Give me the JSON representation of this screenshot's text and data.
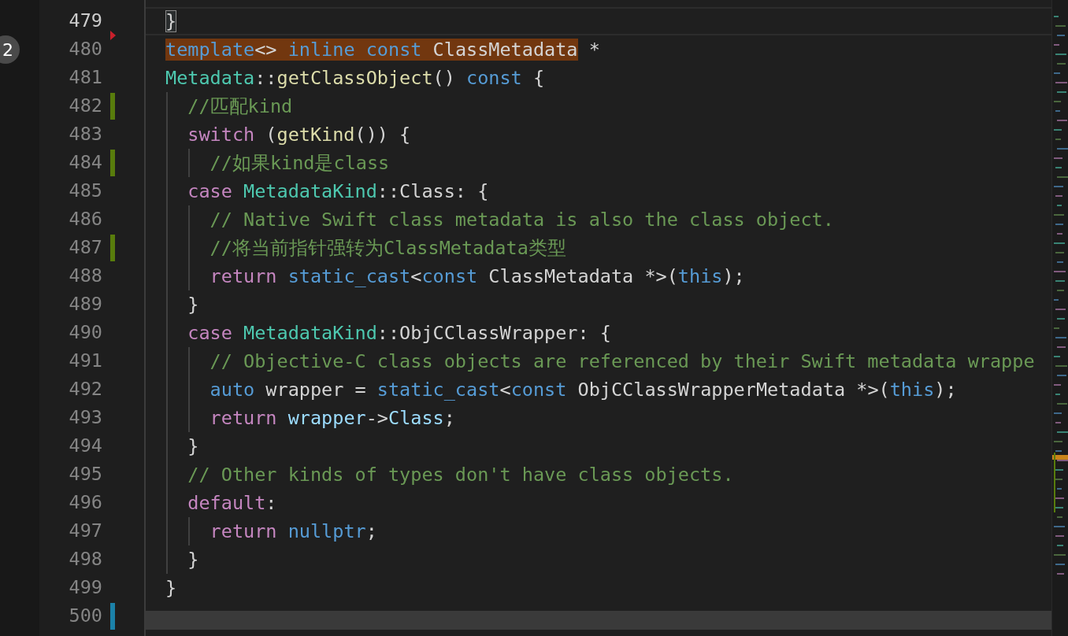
{
  "badge": "2",
  "lines": [
    {
      "number": "479",
      "current": true,
      "added": false,
      "modified": false,
      "deleted_above": false,
      "tokens": [
        {
          "kind": "bracket_match",
          "text": "}"
        }
      ]
    },
    {
      "number": "480",
      "current": false,
      "added": false,
      "modified": false,
      "deleted_above": true,
      "tokens": [
        {
          "kind": "match",
          "tokens": [
            {
              "kind": "keyword",
              "text": "template"
            },
            {
              "kind": "plain",
              "text": "<> "
            },
            {
              "kind": "keyword",
              "text": "inline "
            },
            {
              "kind": "keyword",
              "text": "const"
            },
            {
              "kind": "plain",
              "text": " ClassMetadata"
            }
          ]
        },
        {
          "kind": "plain",
          "text": " *"
        }
      ]
    },
    {
      "number": "481",
      "current": false,
      "added": false,
      "modified": false,
      "deleted_above": false,
      "tokens": [
        {
          "kind": "type",
          "text": "Metadata"
        },
        {
          "kind": "plain",
          "text": "::"
        },
        {
          "kind": "function",
          "text": "getClassObject"
        },
        {
          "kind": "plain",
          "text": "() "
        },
        {
          "kind": "keyword",
          "text": "const"
        },
        {
          "kind": "plain",
          "text": " {"
        }
      ],
      "children": [
        {
          "number": "482",
          "current": false,
          "added": true,
          "modified": false,
          "deleted_above": false,
          "tokens": [
            {
              "kind": "comment",
              "text": "//匹配kind"
            }
          ]
        },
        {
          "number": "483",
          "current": false,
          "added": false,
          "modified": false,
          "deleted_above": false,
          "tokens": [
            {
              "kind": "control",
              "text": "switch"
            },
            {
              "kind": "plain",
              "text": " ("
            },
            {
              "kind": "function",
              "text": "getKind"
            },
            {
              "kind": "plain",
              "text": "()) {"
            }
          ],
          "children": [
            {
              "number": "484",
              "current": false,
              "added": true,
              "modified": false,
              "deleted_above": false,
              "tokens": [
                {
                  "kind": "comment",
                  "text": "//如果kind是class"
                }
              ]
            }
          ]
        },
        {
          "number": "485",
          "current": false,
          "added": false,
          "modified": false,
          "deleted_above": false,
          "tokens": [
            {
              "kind": "control",
              "text": "case "
            },
            {
              "kind": "type",
              "text": "MetadataKind"
            },
            {
              "kind": "plain",
              "text": "::Class: {"
            }
          ],
          "children": [
            {
              "number": "486",
              "current": false,
              "added": false,
              "modified": false,
              "deleted_above": false,
              "tokens": [
                {
                  "kind": "comment",
                  "text": "// Native Swift class metadata is also the class object."
                }
              ]
            },
            {
              "number": "487",
              "current": false,
              "added": true,
              "modified": false,
              "deleted_above": false,
              "tokens": [
                {
                  "kind": "comment",
                  "text": "//将当前指针强转为ClassMetadata类型"
                }
              ]
            },
            {
              "number": "488",
              "current": false,
              "added": false,
              "modified": false,
              "deleted_above": false,
              "tokens": [
                {
                  "kind": "control",
                  "text": "return "
                },
                {
                  "kind": "keyword",
                  "text": "static_cast"
                },
                {
                  "kind": "plain",
                  "text": "<"
                },
                {
                  "kind": "keyword",
                  "text": "const"
                },
                {
                  "kind": "plain",
                  "text": " ClassMetadata *>("
                },
                {
                  "kind": "keyword",
                  "text": "this"
                },
                {
                  "kind": "plain",
                  "text": ");"
                }
              ]
            }
          ]
        },
        {
          "number": "489",
          "current": false,
          "added": false,
          "modified": false,
          "deleted_above": false,
          "tokens": [
            {
              "kind": "plain",
              "text": "}"
            }
          ]
        },
        {
          "number": "490",
          "current": false,
          "added": false,
          "modified": false,
          "deleted_above": false,
          "tokens": [
            {
              "kind": "control",
              "text": "case "
            },
            {
              "kind": "type",
              "text": "MetadataKind"
            },
            {
              "kind": "plain",
              "text": "::ObjCClassWrapper: {"
            }
          ],
          "children": [
            {
              "number": "491",
              "current": false,
              "added": false,
              "modified": false,
              "deleted_above": false,
              "tokens": [
                {
                  "kind": "comment",
                  "text": "// Objective-C class objects are referenced by their Swift metadata wrappe"
                }
              ]
            },
            {
              "number": "492",
              "current": false,
              "added": false,
              "modified": false,
              "deleted_above": false,
              "tokens": [
                {
                  "kind": "keyword",
                  "text": "auto"
                },
                {
                  "kind": "plain",
                  "text": " wrapper = "
                },
                {
                  "kind": "keyword",
                  "text": "static_cast"
                },
                {
                  "kind": "plain",
                  "text": "<"
                },
                {
                  "kind": "keyword",
                  "text": "const"
                },
                {
                  "kind": "plain",
                  "text": " ObjCClassWrapperMetadata *>("
                },
                {
                  "kind": "keyword",
                  "text": "this"
                },
                {
                  "kind": "plain",
                  "text": ");"
                }
              ]
            },
            {
              "number": "493",
              "current": false,
              "added": false,
              "modified": false,
              "deleted_above": false,
              "tokens": [
                {
                  "kind": "control",
                  "text": "return "
                },
                {
                  "kind": "variable",
                  "text": "wrapper"
                },
                {
                  "kind": "plain",
                  "text": "->"
                },
                {
                  "kind": "variable",
                  "text": "Class"
                },
                {
                  "kind": "plain",
                  "text": ";"
                }
              ]
            }
          ]
        },
        {
          "number": "494",
          "current": false,
          "added": false,
          "modified": false,
          "deleted_above": false,
          "tokens": [
            {
              "kind": "plain",
              "text": "}"
            }
          ]
        },
        {
          "number": "495",
          "current": false,
          "added": false,
          "modified": false,
          "deleted_above": false,
          "tokens": [
            {
              "kind": "comment",
              "text": "// Other kinds of types don't have class objects."
            }
          ]
        },
        {
          "number": "496",
          "current": false,
          "added": false,
          "modified": false,
          "deleted_above": false,
          "tokens": [
            {
              "kind": "control",
              "text": "default"
            },
            {
              "kind": "plain",
              "text": ":"
            }
          ],
          "children": [
            {
              "number": "497",
              "current": false,
              "added": false,
              "modified": false,
              "deleted_above": false,
              "tokens": [
                {
                  "kind": "control",
                  "text": "return "
                },
                {
                  "kind": "keyword",
                  "text": "nullptr"
                },
                {
                  "kind": "plain",
                  "text": ";"
                }
              ]
            }
          ]
        },
        {
          "number": "498",
          "current": false,
          "added": false,
          "modified": false,
          "deleted_above": false,
          "tokens": [
            {
              "kind": "plain",
              "text": "}"
            }
          ]
        }
      ]
    },
    {
      "number": "499",
      "current": false,
      "added": false,
      "modified": false,
      "deleted_above": false,
      "tokens": [
        {
          "kind": "plain",
          "text": "}"
        }
      ]
    },
    {
      "number": "500",
      "current": false,
      "added": false,
      "modified": true,
      "deleted_above": false
    }
  ]
}
